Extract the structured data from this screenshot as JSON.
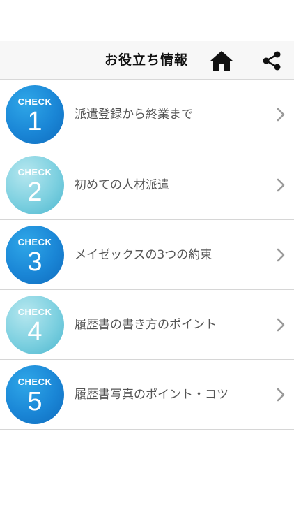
{
  "header": {
    "title": "お役立ち情報",
    "home_icon": "home-icon",
    "share_icon": "share-icon"
  },
  "items": [
    {
      "badge_label": "CHECK",
      "number": "1",
      "label": "派遣登録から終業まで",
      "style": "dark"
    },
    {
      "badge_label": "CHECK",
      "number": "2",
      "label": "初めての人材派遣",
      "style": "light"
    },
    {
      "badge_label": "CHECK",
      "number": "3",
      "label": "メイゼックスの3つの約束",
      "style": "dark"
    },
    {
      "badge_label": "CHECK",
      "number": "4",
      "label": "履歴書の書き方のポイント",
      "style": "light"
    },
    {
      "badge_label": "CHECK",
      "number": "5",
      "label": "履歴書写真のポイント・コツ",
      "style": "dark"
    }
  ],
  "colors": {
    "badge_dark": "#1a86d6",
    "badge_light": "#7dd0e0",
    "chevron": "#9a9a9a"
  }
}
